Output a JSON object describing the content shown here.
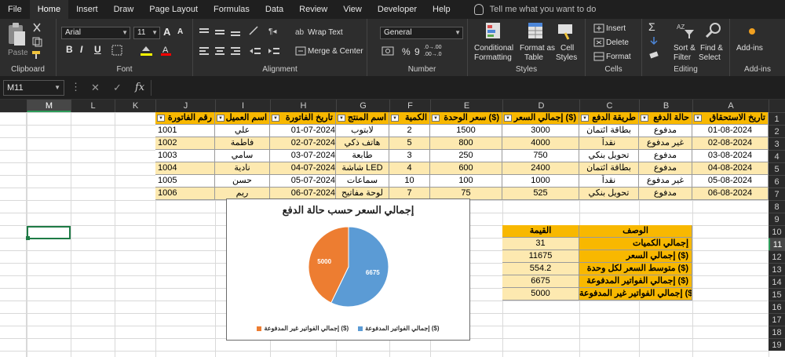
{
  "menu": {
    "tabs": [
      "File",
      "Home",
      "Insert",
      "Draw",
      "Page Layout",
      "Formulas",
      "Data",
      "Review",
      "View",
      "Developer",
      "Help"
    ],
    "active": "Home",
    "tellme": "Tell me what you want to do"
  },
  "ribbon": {
    "clipboard": {
      "label": "Clipboard",
      "paste": "Paste"
    },
    "font": {
      "label": "Font",
      "name": "Arial",
      "size": "11",
      "bold": "B",
      "italic": "I",
      "underline": "U",
      "grow": "A",
      "shrink": "A"
    },
    "alignment": {
      "label": "Alignment",
      "wrap": "Wrap Text",
      "merge": "Merge & Center"
    },
    "number": {
      "label": "Number",
      "format": "General",
      "percent": "%",
      "comma": "9",
      "inc": ".0→.00",
      "dec": ".00→.0"
    },
    "styles": {
      "label": "Styles",
      "conditional": "Conditional",
      "conditional2": "Formatting",
      "format_table": "Format as",
      "format_table2": "Table",
      "cell_styles": "Cell",
      "cell_styles2": "Styles"
    },
    "cells": {
      "label": "Cells",
      "insert": "Insert",
      "delete": "Delete",
      "format": "Format"
    },
    "editing": {
      "label": "Editing",
      "sort": "Sort &",
      "sort2": "Filter",
      "find": "Find &",
      "find2": "Select"
    },
    "addins": {
      "label": "Add-ins",
      "btn": "Add-ins"
    }
  },
  "formula_bar": {
    "name_box": "M11",
    "cancel": "✕",
    "enter": "✓",
    "fx": "fx"
  },
  "columns": [
    "M",
    "L",
    "K",
    "J",
    "I",
    "H",
    "G",
    "F",
    "E",
    "D",
    "C",
    "B",
    "A"
  ],
  "rows": [
    "1",
    "2",
    "3",
    "4",
    "5",
    "6",
    "7",
    "8",
    "9",
    "10",
    "11",
    "12",
    "13",
    "14",
    "15",
    "16",
    "17",
    "18",
    "19"
  ],
  "table": {
    "headers": [
      "رقم الفاتورة",
      "اسم العميل",
      "تاريخ الفاتورة",
      "اسم المنتج",
      "الكمية",
      "سعر الوحدة ($)",
      "إجمالي السعر ($)",
      "طريقة الدفع",
      "حالة الدفع",
      "تاريخ الاستحقاق"
    ],
    "rows": [
      [
        "1001",
        "علي",
        "01-07-2024",
        "لابتوب",
        "2",
        "1500",
        "3000",
        "بطاقة ائتمان",
        "مدفوع",
        "01-08-2024"
      ],
      [
        "1002",
        "فاطمة",
        "02-07-2024",
        "هاتف ذكي",
        "5",
        "800",
        "4000",
        "نقداً",
        "غير مدفوع",
        "02-08-2024"
      ],
      [
        "1003",
        "سامي",
        "03-07-2024",
        "طابعة",
        "3",
        "250",
        "750",
        "تحويل بنكي",
        "مدفوع",
        "03-08-2024"
      ],
      [
        "1004",
        "نادية",
        "04-07-2024",
        "شاشة LED",
        "4",
        "600",
        "2400",
        "بطاقة ائتمان",
        "مدفوع",
        "04-08-2024"
      ],
      [
        "1005",
        "حسن",
        "05-07-2024",
        "سماعات",
        "10",
        "100",
        "1000",
        "نقداً",
        "غير مدفوع",
        "05-08-2024"
      ],
      [
        "1006",
        "ريم",
        "06-07-2024",
        "لوحة مفاتيح",
        "7",
        "75",
        "525",
        "تحويل بنكي",
        "مدفوع",
        "06-08-2024"
      ]
    ]
  },
  "summary": {
    "header_value": "القيمة",
    "header_desc": "الوصف",
    "rows": [
      [
        "31",
        "إجمالي الكميات"
      ],
      [
        "11675",
        "إجمالي السعر ($)"
      ],
      [
        "554.2",
        "متوسط السعر لكل وحدة ($)"
      ],
      [
        "6675",
        "إجمالي الفواتير المدفوعة ($)"
      ],
      [
        "5000",
        "إجمالي الفواتير غير المدفوعة ($)"
      ]
    ]
  },
  "chart_data": {
    "type": "pie",
    "title": "إجمالي السعر حسب حالة الدفع",
    "categories": [
      "إجمالي الفواتير المدفوعة ($)",
      "إجمالي الفواتير غير المدفوعة ($)"
    ],
    "values": [
      6675,
      5000
    ],
    "data_labels": [
      "6675",
      "5000"
    ],
    "colors": [
      "#5b9bd5",
      "#ed7d31"
    ],
    "legend": "bottom"
  },
  "colors": {
    "accent": "#f8b800",
    "band": "#fde9b0",
    "selection": "#1e7b45"
  }
}
